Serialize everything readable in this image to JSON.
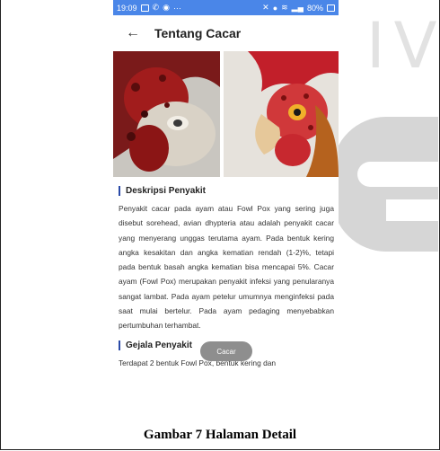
{
  "status_bar": {
    "time": "19:09",
    "right_text": "80%",
    "left_icons": [
      "gallery-icon",
      "phone-icon",
      "chat-icon",
      "more-icon"
    ],
    "right_icons": [
      "mute-icon",
      "location-icon",
      "wifi-icon",
      "signal-icon",
      "battery-icon"
    ]
  },
  "app_bar": {
    "back_icon": "arrow-left-icon",
    "title": "Tentang Cacar"
  },
  "hero_image": {
    "description_icon": "chicken-photo"
  },
  "sections": [
    {
      "title": "Deskripsi Penyakit",
      "body": "Penyakit cacar pada ayam atau Fowl Pox yang sering juga disebut sorehead, avian dhypteria atau adalah penyakit cacar yang menyerang unggas terutama ayam. Pada bentuk kering angka kesakitan dan angka kematian rendah (1-2)%, tetapi pada bentuk basah angka kematian bisa mencapai 5%. Cacar ayam (Fowl Pox) merupakan penyakit infeksi yang penularanya sangat lambat. Pada ayam petelur umumnya menginfeksi pada saat mulai bertelur. Pada ayam pedaging menyebabkan pertumbuhan terhambat."
    },
    {
      "title": "Gejala Penyakit",
      "body": "Terdapat 2 bentuk Fowl Pox, bentuk kering dan"
    }
  ],
  "toast": {
    "label": "Cacar"
  },
  "caption": "Gambar 7 Halaman Detail",
  "colors": {
    "status_bar": "#4a86e8",
    "accent_bar": "#2a4aa8",
    "toast": "#888888"
  }
}
